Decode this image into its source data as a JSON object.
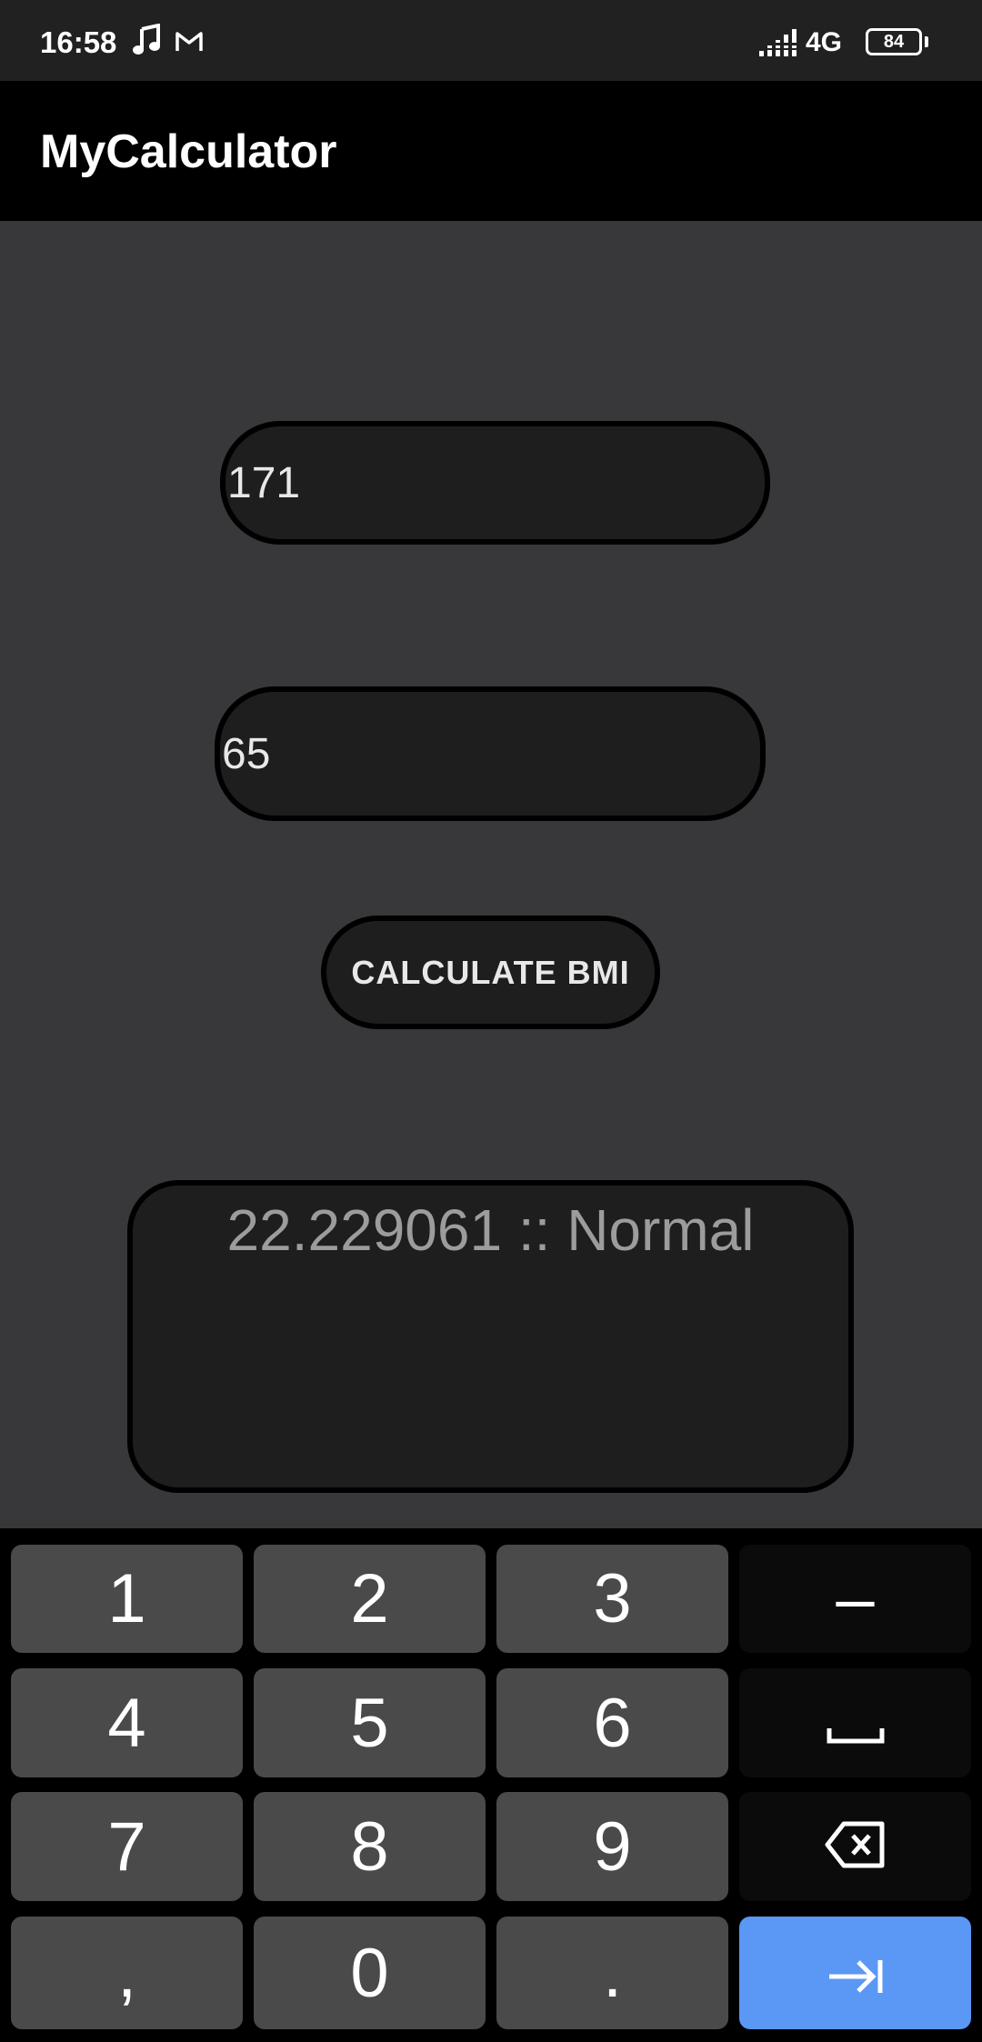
{
  "status_bar": {
    "time": "16:58",
    "network": "4G",
    "battery_level": "84",
    "icons": [
      "music-note-icon",
      "gmail-icon",
      "signal-icon",
      "battery-icon"
    ]
  },
  "app_bar": {
    "title": "MyCalculator"
  },
  "form": {
    "height_value": "171",
    "weight_value": "65",
    "calculate_label": "CALCULATE BMI",
    "result_text": "22.229061 :: Normal"
  },
  "keyboard": {
    "row1": [
      "1",
      "2",
      "3",
      "–"
    ],
    "row2": [
      "4",
      "5",
      "6",
      "space-icon"
    ],
    "row3": [
      "7",
      "8",
      "9",
      "backspace-icon"
    ],
    "row4": [
      ",",
      "0",
      ".",
      "next-icon"
    ]
  },
  "colors": {
    "background": "#38373a",
    "app_bar": "#000000",
    "field": "#1e1e1e",
    "key": "#4a4a4a",
    "key_dark": "#0b0b0b",
    "accent": "#5b97f5"
  }
}
